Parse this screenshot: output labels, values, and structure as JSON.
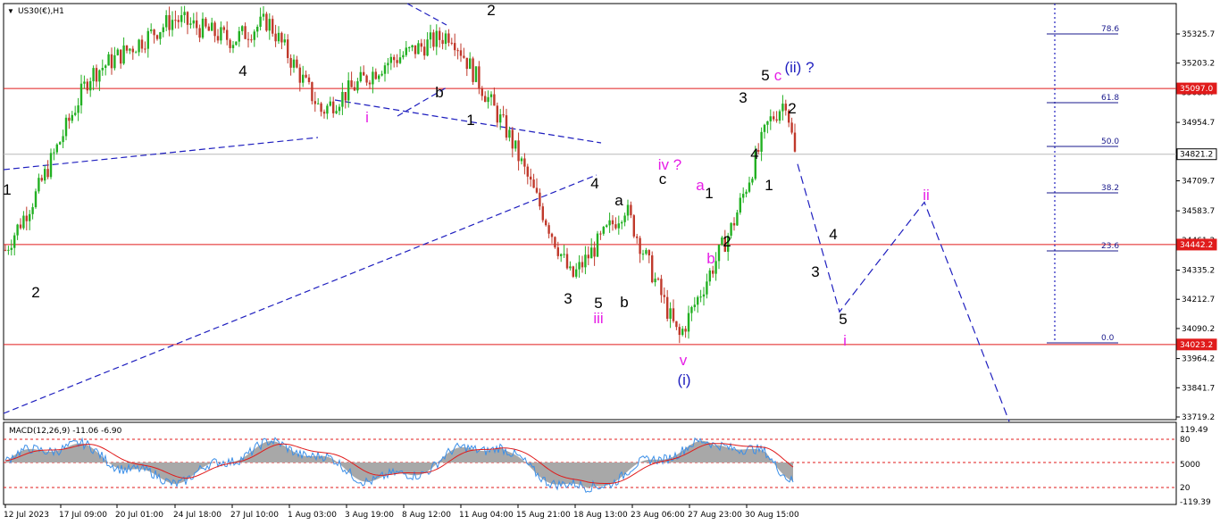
{
  "header": {
    "symbol_label": "US30(€),H1"
  },
  "macd": {
    "label": "MACD(12,26,9) -11.06 -6.90",
    "scale": [
      "119.49",
      "80",
      "5000",
      "20",
      "-119.39"
    ]
  },
  "price_axis": {
    "ticks": [
      "35325.7",
      "35203.2",
      "35080.7",
      "34954.7",
      "34832.2",
      "34709.7",
      "34583.7",
      "34461.2",
      "34335.2",
      "34212.7",
      "34090.2",
      "33964.2",
      "33841.7",
      "33719.2"
    ]
  },
  "price_tags": [
    {
      "value": "35097.0",
      "color": "#e01b1b"
    },
    {
      "value": "34821.2",
      "color": "#000000"
    },
    {
      "value": "34442.2",
      "color": "#e01b1b"
    },
    {
      "value": "34023.2",
      "color": "#e01b1b"
    }
  ],
  "fibonacci": [
    "78.6",
    "61.8",
    "50.0",
    "38.2",
    "23.6",
    "0.0"
  ],
  "time_axis": [
    "12 Jul 2023",
    "17 Jul 09:00",
    "20 Jul 01:00",
    "24 Jul 18:00",
    "27 Jul 10:00",
    "1 Aug 03:00",
    "3 Aug 19:00",
    "8 Aug 12:00",
    "11 Aug 04:00",
    "15 Aug 21:00",
    "18 Aug 13:00",
    "23 Aug 06:00",
    "27 Aug 23:00",
    "30 Aug 15:00"
  ],
  "wave_labels": [
    {
      "text": "1",
      "color": "#000000"
    },
    {
      "text": "2",
      "color": "#000000"
    },
    {
      "text": "4",
      "color": "#000000"
    },
    {
      "text": "2",
      "color": "#000000"
    },
    {
      "text": "i",
      "color": "#e61ee6"
    },
    {
      "text": "b",
      "color": "#000000"
    },
    {
      "text": "1",
      "color": "#000000"
    },
    {
      "text": "4",
      "color": "#000000"
    },
    {
      "text": "3",
      "color": "#000000"
    },
    {
      "text": "5",
      "color": "#000000"
    },
    {
      "text": "iii",
      "color": "#e61ee6"
    },
    {
      "text": "a",
      "color": "#000000"
    },
    {
      "text": "b",
      "color": "#000000"
    },
    {
      "text": "c",
      "color": "#000000"
    },
    {
      "text": "iv ?",
      "color": "#e61ee6"
    },
    {
      "text": "v",
      "color": "#e61ee6"
    },
    {
      "text": "(i)",
      "color": "#1f1fbf"
    },
    {
      "text": "a",
      "color": "#e61ee6"
    },
    {
      "text": "b",
      "color": "#e61ee6"
    },
    {
      "text": "1",
      "color": "#000000"
    },
    {
      "text": "2",
      "color": "#000000"
    },
    {
      "text": "3",
      "color": "#000000"
    },
    {
      "text": "4",
      "color": "#000000"
    },
    {
      "text": "5",
      "color": "#000000"
    },
    {
      "text": "c",
      "color": "#e61ee6"
    },
    {
      "text": "(ii) ?",
      "color": "#1f1fbf"
    },
    {
      "text": "1",
      "color": "#000000"
    },
    {
      "text": "2",
      "color": "#000000"
    },
    {
      "text": "3",
      "color": "#000000"
    },
    {
      "text": "4",
      "color": "#000000"
    },
    {
      "text": "5",
      "color": "#000000"
    },
    {
      "text": "i",
      "color": "#e61ee6"
    },
    {
      "text": "ii",
      "color": "#e61ee6"
    }
  ],
  "chart_data": {
    "type": "line",
    "title": "",
    "xlabel": "",
    "ylabel": "",
    "ylim": [
      33680,
      35400
    ],
    "grid": false,
    "x": [
      "12 Jul 2023",
      "17 Jul 09:00",
      "20 Jul 01:00",
      "24 Jul 18:00",
      "27 Jul 10:00",
      "1 Aug 03:00",
      "3 Aug 19:00",
      "8 Aug 12:00",
      "11 Aug 04:00",
      "15 Aug 21:00",
      "18 Aug 13:00",
      "23 Aug 06:00",
      "27 Aug 23:00",
      "30 Aug 15:00"
    ],
    "series": [
      {
        "values": [
          34420,
          34650,
          35150,
          35390,
          35300,
          35380,
          35000,
          35200,
          35330,
          34900,
          34300,
          34600,
          34050,
          34520,
          34950,
          35050,
          34750
        ]
      }
    ],
    "forecast_path": [
      34780,
      34160,
      34620,
      33700
    ],
    "horizontal_levels": [
      35097.0,
      34821.2,
      34442.2,
      34023.2
    ],
    "fib_levels": [
      78.6,
      61.8,
      50.0,
      38.2,
      23.6,
      0.0
    ],
    "colors": {
      "up": "#22b022",
      "down": "#c0392b",
      "level": "#e01b1b",
      "trend": "#1f1fbf"
    }
  }
}
